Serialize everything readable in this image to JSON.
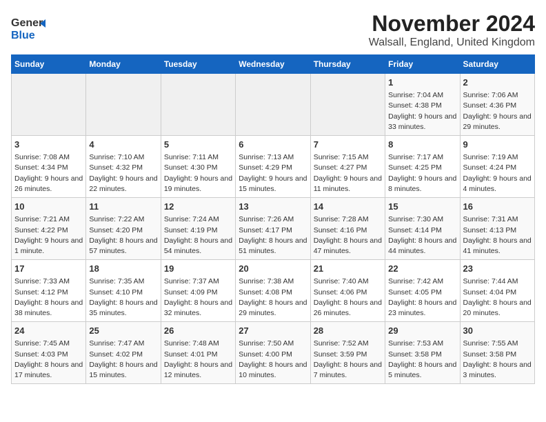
{
  "header": {
    "logo_general": "General",
    "logo_blue": "Blue",
    "month_title": "November 2024",
    "location": "Walsall, England, United Kingdom"
  },
  "weekdays": [
    "Sunday",
    "Monday",
    "Tuesday",
    "Wednesday",
    "Thursday",
    "Friday",
    "Saturday"
  ],
  "weeks": [
    [
      {
        "day": "",
        "info": ""
      },
      {
        "day": "",
        "info": ""
      },
      {
        "day": "",
        "info": ""
      },
      {
        "day": "",
        "info": ""
      },
      {
        "day": "",
        "info": ""
      },
      {
        "day": "1",
        "info": "Sunrise: 7:04 AM\nSunset: 4:38 PM\nDaylight: 9 hours and 33 minutes."
      },
      {
        "day": "2",
        "info": "Sunrise: 7:06 AM\nSunset: 4:36 PM\nDaylight: 9 hours and 29 minutes."
      }
    ],
    [
      {
        "day": "3",
        "info": "Sunrise: 7:08 AM\nSunset: 4:34 PM\nDaylight: 9 hours and 26 minutes."
      },
      {
        "day": "4",
        "info": "Sunrise: 7:10 AM\nSunset: 4:32 PM\nDaylight: 9 hours and 22 minutes."
      },
      {
        "day": "5",
        "info": "Sunrise: 7:11 AM\nSunset: 4:30 PM\nDaylight: 9 hours and 19 minutes."
      },
      {
        "day": "6",
        "info": "Sunrise: 7:13 AM\nSunset: 4:29 PM\nDaylight: 9 hours and 15 minutes."
      },
      {
        "day": "7",
        "info": "Sunrise: 7:15 AM\nSunset: 4:27 PM\nDaylight: 9 hours and 11 minutes."
      },
      {
        "day": "8",
        "info": "Sunrise: 7:17 AM\nSunset: 4:25 PM\nDaylight: 9 hours and 8 minutes."
      },
      {
        "day": "9",
        "info": "Sunrise: 7:19 AM\nSunset: 4:24 PM\nDaylight: 9 hours and 4 minutes."
      }
    ],
    [
      {
        "day": "10",
        "info": "Sunrise: 7:21 AM\nSunset: 4:22 PM\nDaylight: 9 hours and 1 minute."
      },
      {
        "day": "11",
        "info": "Sunrise: 7:22 AM\nSunset: 4:20 PM\nDaylight: 8 hours and 57 minutes."
      },
      {
        "day": "12",
        "info": "Sunrise: 7:24 AM\nSunset: 4:19 PM\nDaylight: 8 hours and 54 minutes."
      },
      {
        "day": "13",
        "info": "Sunrise: 7:26 AM\nSunset: 4:17 PM\nDaylight: 8 hours and 51 minutes."
      },
      {
        "day": "14",
        "info": "Sunrise: 7:28 AM\nSunset: 4:16 PM\nDaylight: 8 hours and 47 minutes."
      },
      {
        "day": "15",
        "info": "Sunrise: 7:30 AM\nSunset: 4:14 PM\nDaylight: 8 hours and 44 minutes."
      },
      {
        "day": "16",
        "info": "Sunrise: 7:31 AM\nSunset: 4:13 PM\nDaylight: 8 hours and 41 minutes."
      }
    ],
    [
      {
        "day": "17",
        "info": "Sunrise: 7:33 AM\nSunset: 4:12 PM\nDaylight: 8 hours and 38 minutes."
      },
      {
        "day": "18",
        "info": "Sunrise: 7:35 AM\nSunset: 4:10 PM\nDaylight: 8 hours and 35 minutes."
      },
      {
        "day": "19",
        "info": "Sunrise: 7:37 AM\nSunset: 4:09 PM\nDaylight: 8 hours and 32 minutes."
      },
      {
        "day": "20",
        "info": "Sunrise: 7:38 AM\nSunset: 4:08 PM\nDaylight: 8 hours and 29 minutes."
      },
      {
        "day": "21",
        "info": "Sunrise: 7:40 AM\nSunset: 4:06 PM\nDaylight: 8 hours and 26 minutes."
      },
      {
        "day": "22",
        "info": "Sunrise: 7:42 AM\nSunset: 4:05 PM\nDaylight: 8 hours and 23 minutes."
      },
      {
        "day": "23",
        "info": "Sunrise: 7:44 AM\nSunset: 4:04 PM\nDaylight: 8 hours and 20 minutes."
      }
    ],
    [
      {
        "day": "24",
        "info": "Sunrise: 7:45 AM\nSunset: 4:03 PM\nDaylight: 8 hours and 17 minutes."
      },
      {
        "day": "25",
        "info": "Sunrise: 7:47 AM\nSunset: 4:02 PM\nDaylight: 8 hours and 15 minutes."
      },
      {
        "day": "26",
        "info": "Sunrise: 7:48 AM\nSunset: 4:01 PM\nDaylight: 8 hours and 12 minutes."
      },
      {
        "day": "27",
        "info": "Sunrise: 7:50 AM\nSunset: 4:00 PM\nDaylight: 8 hours and 10 minutes."
      },
      {
        "day": "28",
        "info": "Sunrise: 7:52 AM\nSunset: 3:59 PM\nDaylight: 8 hours and 7 minutes."
      },
      {
        "day": "29",
        "info": "Sunrise: 7:53 AM\nSunset: 3:58 PM\nDaylight: 8 hours and 5 minutes."
      },
      {
        "day": "30",
        "info": "Sunrise: 7:55 AM\nSunset: 3:58 PM\nDaylight: 8 hours and 3 minutes."
      }
    ]
  ]
}
